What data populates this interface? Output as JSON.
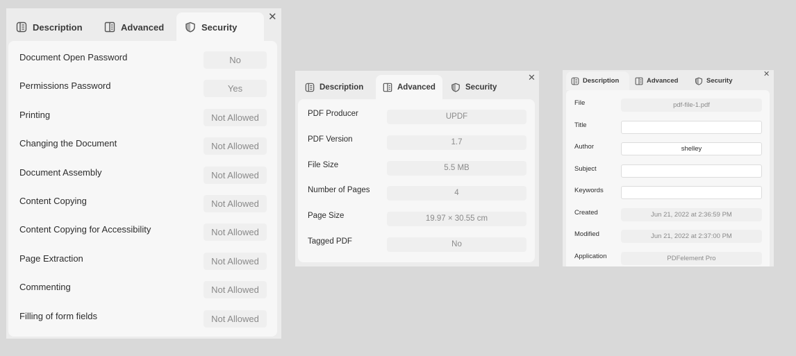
{
  "tabs": [
    {
      "label": "Description",
      "icon": "description-icon"
    },
    {
      "label": "Advanced",
      "icon": "advanced-icon"
    },
    {
      "label": "Security",
      "icon": "shield-icon"
    }
  ],
  "close_glyph": "✕",
  "security_window": {
    "active_tab": "Security",
    "rows": [
      {
        "label": "Document Open Password",
        "value": "No"
      },
      {
        "label": "Permissions Password",
        "value": "Yes"
      },
      {
        "label": "Printing",
        "value": "Not Allowed"
      },
      {
        "label": "Changing the Document",
        "value": "Not Allowed"
      },
      {
        "label": "Document Assembly",
        "value": "Not Allowed"
      },
      {
        "label": "Content Copying",
        "value": "Not Allowed"
      },
      {
        "label": "Content Copying for Accessibility",
        "value": "Not Allowed"
      },
      {
        "label": "Page Extraction",
        "value": "Not Allowed"
      },
      {
        "label": "Commenting",
        "value": "Not Allowed"
      },
      {
        "label": "Filling of form fields",
        "value": "Not Allowed"
      }
    ]
  },
  "advanced_window": {
    "active_tab": "Advanced",
    "rows": [
      {
        "label": "PDF Producer",
        "value": "UPDF"
      },
      {
        "label": "PDF Version",
        "value": "1.7"
      },
      {
        "label": "File Size",
        "value": "5.5 MB"
      },
      {
        "label": "Number of Pages",
        "value": "4"
      },
      {
        "label": "Page Size",
        "value": "19.97 × 30.55 cm"
      },
      {
        "label": "Tagged PDF",
        "value": "No"
      }
    ]
  },
  "description_window": {
    "active_tab": "Description",
    "rows": [
      {
        "label": "File",
        "value": "pdf-file-1.pdf",
        "editable": false
      },
      {
        "label": "Title",
        "value": "",
        "editable": true
      },
      {
        "label": "Author",
        "value": "shelley",
        "editable": true
      },
      {
        "label": "Subject",
        "value": "",
        "editable": true
      },
      {
        "label": "Keywords",
        "value": "",
        "editable": true
      },
      {
        "label": "Created",
        "value": "Jun 21, 2022 at 2:36:59 PM",
        "editable": false
      },
      {
        "label": "Modified",
        "value": "Jun 21, 2022 at 2:37:00 PM",
        "editable": false
      },
      {
        "label": "Application",
        "value": "PDFelement Pro",
        "editable": false
      }
    ]
  }
}
